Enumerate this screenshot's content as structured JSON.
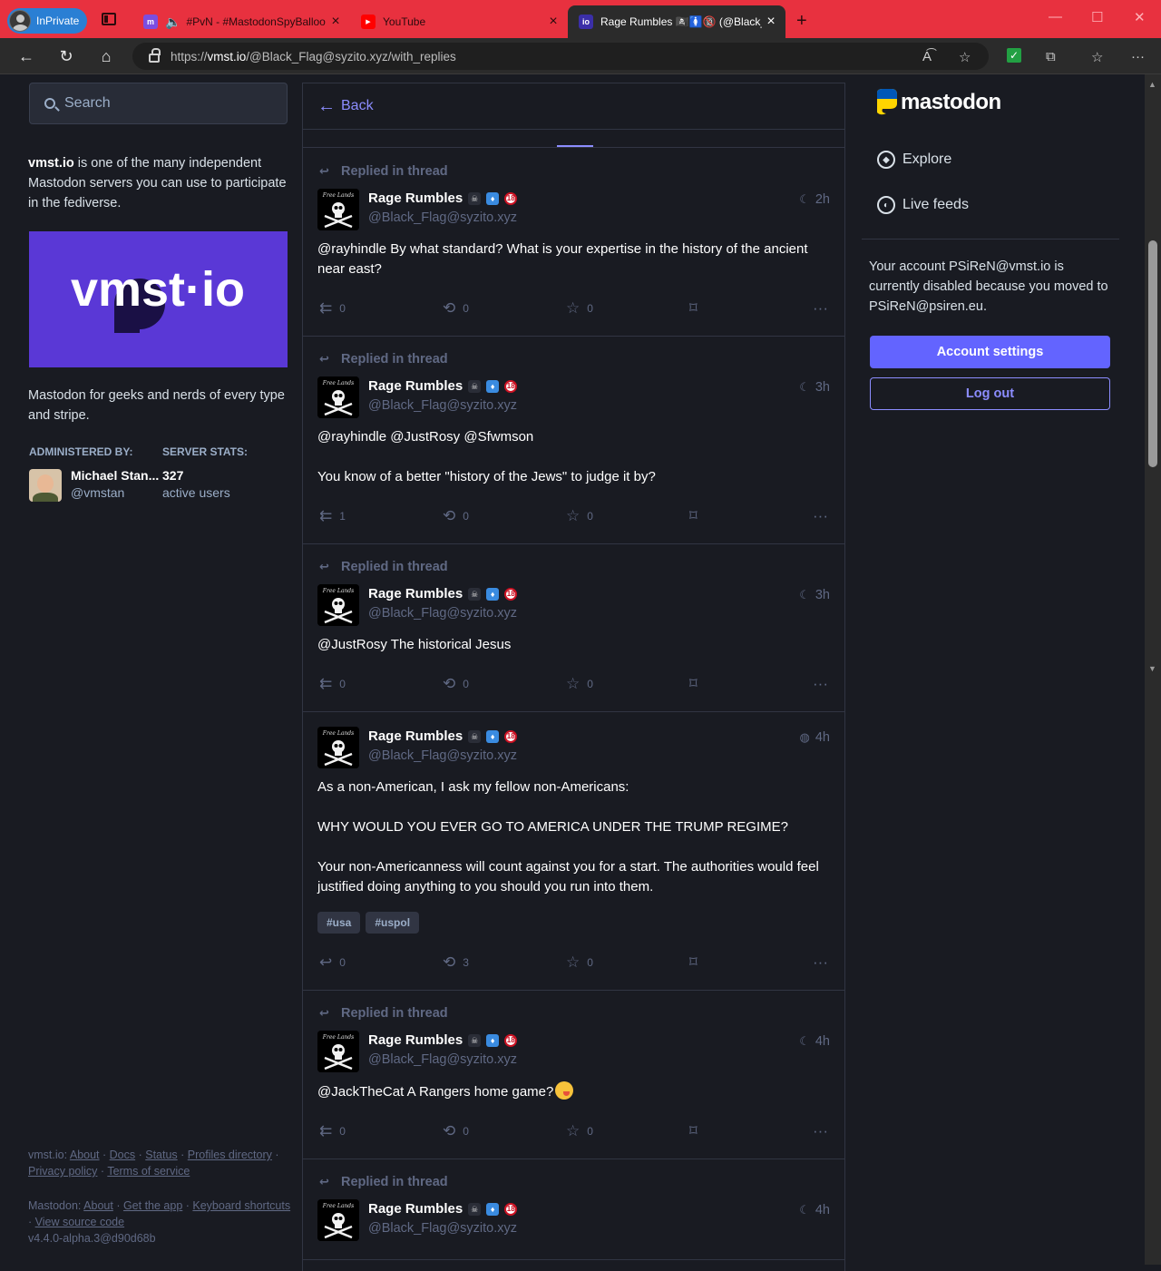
{
  "browser": {
    "inprivate_label": "InPrivate",
    "tabs": [
      {
        "title": "#PvN - #MastodonSpyBalloo",
        "favicon_color": "#7b4ee0",
        "favicon": "m"
      },
      {
        "title": "YouTube",
        "favicon_color": "#ff0000",
        "favicon": "▶"
      },
      {
        "title": "Rage Rumbles 🏴‍☠️🚺🔞 (@Black_Fl",
        "favicon_color": "#3b2fa8",
        "favicon": "io"
      }
    ],
    "url_prefix": "https://",
    "url_host": "vmst.io",
    "url_path": "/@Black_Flag@syzito.xyz/with_replies"
  },
  "sidebar": {
    "search_placeholder": "Search",
    "about_server": "vmst.io",
    "about_text": " is one of the many independent Mastodon servers you can use to participate in the fediverse.",
    "hero_text": "vmst·io",
    "description": "Mastodon for geeks and nerds of every type and stripe.",
    "admin_heading": "ADMINISTERED BY:",
    "stats_heading": "SERVER STATS:",
    "admin_name": "Michael Stan...",
    "admin_acct": "@vmstan",
    "active_users": "327",
    "active_label": "active users",
    "footer": {
      "server": "vmst.io",
      "links1": [
        "About",
        "Docs",
        "Status",
        "Profiles directory",
        "Privacy policy",
        "Terms of service"
      ],
      "mastodon": "Mastodon",
      "links2": [
        "About",
        "Get the app",
        "Keyboard shortcuts",
        "View source code"
      ],
      "version": "v4.4.0-alpha.3@d90d68b"
    }
  },
  "column": {
    "back_label": "Back",
    "statuses": [
      {
        "prepend": "Replied in thread",
        "display_name": "Rage Rumbles",
        "acct": "@Black_Flag@syzito.xyz",
        "time": "2h",
        "visibility": "moon-icon",
        "paragraphs": [
          "@rayhindle By what standard? What is your expertise in the history of the ancient near east?"
        ],
        "replies": "0",
        "boosts": "0",
        "favs": "0",
        "reply_icon": "reply-all"
      },
      {
        "prepend": "Replied in thread",
        "display_name": "Rage Rumbles",
        "acct": "@Black_Flag@syzito.xyz",
        "time": "3h",
        "visibility": "moon-icon",
        "paragraphs": [
          "@rayhindle @JustRosy @Sfwmson",
          "You know of a better \"history of the Jews\" to judge it by?"
        ],
        "replies": "1",
        "boosts": "0",
        "favs": "0",
        "reply_icon": "reply-all"
      },
      {
        "prepend": "Replied in thread",
        "display_name": "Rage Rumbles",
        "acct": "@Black_Flag@syzito.xyz",
        "time": "3h",
        "visibility": "moon-icon",
        "paragraphs": [
          "@JustRosy The historical Jesus"
        ],
        "replies": "0",
        "boosts": "0",
        "favs": "0",
        "reply_icon": "reply-all"
      },
      {
        "prepend": "",
        "display_name": "Rage Rumbles",
        "acct": "@Black_Flag@syzito.xyz",
        "time": "4h",
        "visibility": "globe-icon",
        "paragraphs": [
          "As a non-American, I ask my fellow non-Americans:",
          "WHY WOULD YOU EVER GO TO AMERICA UNDER THE TRUMP REGIME?",
          "Your non-Americanness will count against you for a start. The authorities would feel justified doing anything to you should you run into them."
        ],
        "tags": [
          "#usa",
          "#uspol"
        ],
        "replies": "0",
        "boosts": "3",
        "favs": "0",
        "reply_icon": "reply"
      },
      {
        "prepend": "Replied in thread",
        "display_name": "Rage Rumbles",
        "acct": "@Black_Flag@syzito.xyz",
        "time": "4h",
        "visibility": "moon-icon",
        "paragraphs": [
          "@JackTheCat A Rangers home game?"
        ],
        "emoji_after": true,
        "replies": "0",
        "boosts": "0",
        "favs": "0",
        "reply_icon": "reply-all"
      },
      {
        "prepend": "Replied in thread",
        "display_name": "Rage Rumbles",
        "acct": "@Black_Flag@syzito.xyz",
        "time": "4h",
        "visibility": "moon-icon",
        "paragraphs": [],
        "partial": true
      }
    ]
  },
  "right": {
    "wordmark": "mastodon",
    "explore": "Explore",
    "live_feeds": "Live feeds",
    "moved_notice": "Your account PSiReN@vmst.io is currently disabled because you moved to PSiReN@psiren.eu.",
    "account_settings": "Account settings",
    "log_out": "Log out"
  },
  "colors": {
    "accent": "#6364ff",
    "accent_light": "#8c8dff",
    "background": "#191b22",
    "muted": "#606984",
    "tab_bar": "#e8313f"
  }
}
